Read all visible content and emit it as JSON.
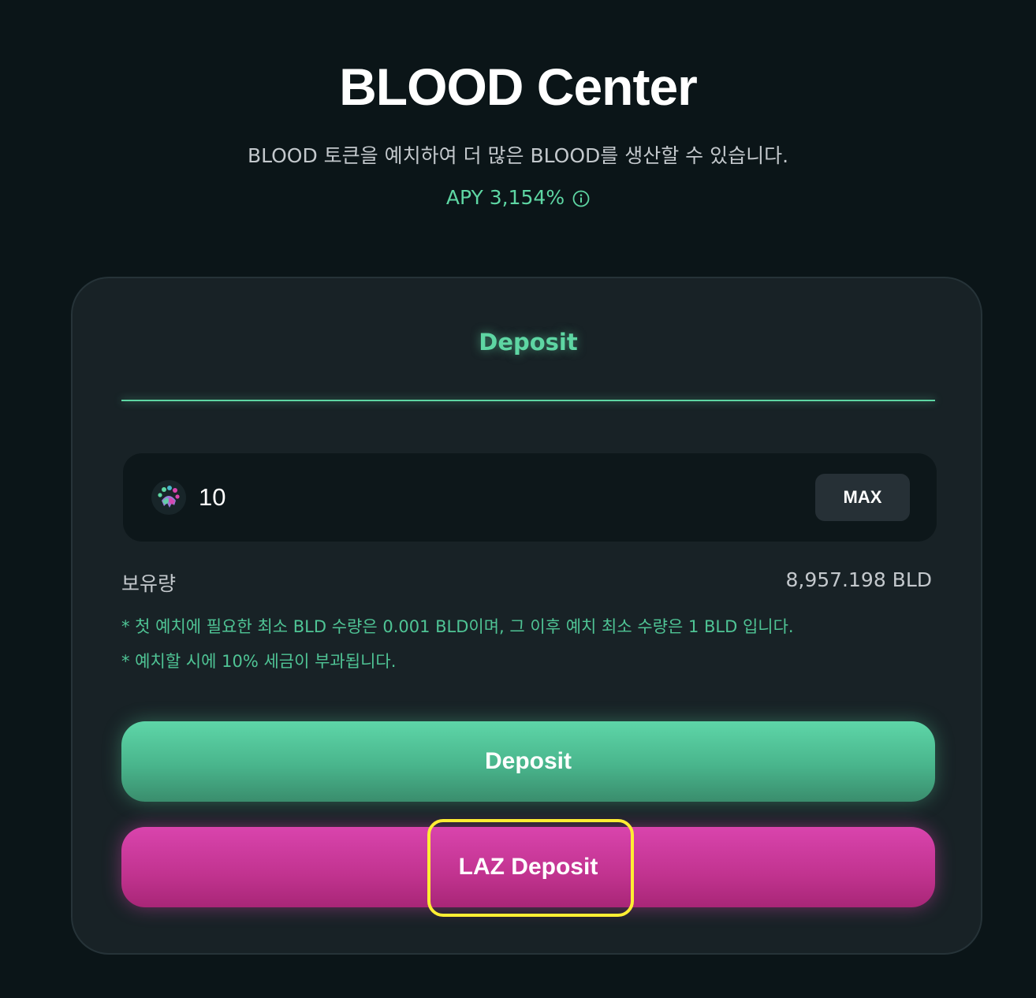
{
  "header": {
    "title": "BLOOD Center",
    "subtitle": "BLOOD 토큰을 예치하여 더 많은 BLOOD를 생산할 수 있습니다.",
    "apy_label": "APY 3,154%",
    "apy_info_icon": "info-circle-icon"
  },
  "card": {
    "tab_label": "Deposit",
    "amount_input": {
      "value": "10",
      "token_icon": "blood-paw-token-icon"
    },
    "max_label": "MAX",
    "holding": {
      "label": "보유량",
      "value": "8,957.198 BLD"
    },
    "notes": [
      "* 첫 예치에 필요한 최소 BLD 수량은 0.001 BLD이며, 그 이후 예치 최소 수량은 1 BLD 입니다.",
      "* 예치할 시에 10% 세금이 부과됩니다."
    ],
    "deposit_button_label": "Deposit",
    "laz_deposit_button_label": "LAZ Deposit"
  },
  "colors": {
    "background": "#0b1518",
    "card": "#182226",
    "accent_green": "#5ed6a3",
    "accent_pink": "#d944ad",
    "highlight": "#ffee33"
  }
}
